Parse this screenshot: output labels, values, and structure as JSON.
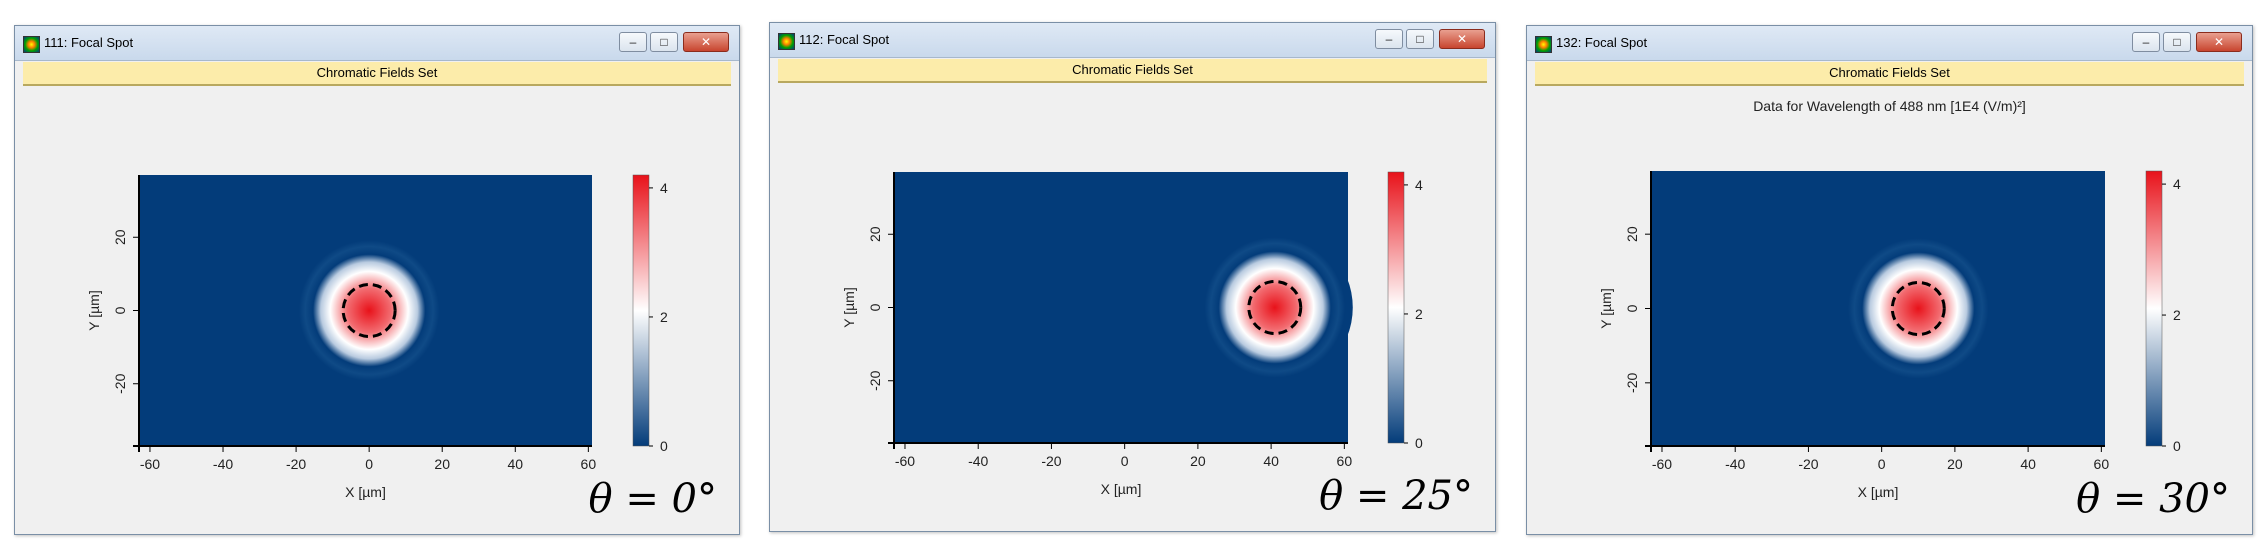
{
  "windows": [
    {
      "title": "111: Focal Spot",
      "header": "Chromatic Fields Set",
      "plot_title": "",
      "angle_label": "θ = 0°",
      "spot_x": 0,
      "spot_y": 0,
      "window_buttons": {
        "minimize": "–",
        "maximize": "□",
        "close": "✕"
      }
    },
    {
      "title": "112: Focal Spot",
      "header": "Chromatic Fields Set",
      "plot_title": "",
      "angle_label": "θ = 25°",
      "spot_x": 41,
      "spot_y": 0,
      "window_buttons": {
        "minimize": "–",
        "maximize": "□",
        "close": "✕"
      }
    },
    {
      "title": "132: Focal Spot",
      "header": "Chromatic Fields Set",
      "plot_title": "Data for Wavelength of 488 nm  [1E4 (V/m)²]",
      "angle_label": "θ = 30°",
      "spot_x": 10,
      "spot_y": 0,
      "window_buttons": {
        "minimize": "–",
        "maximize": "□",
        "close": "✕"
      }
    }
  ],
  "plot": {
    "xlabel": "X [µm]",
    "ylabel": "Y [µm]",
    "x_ticks": [
      -60,
      -40,
      -20,
      0,
      20,
      40,
      60
    ],
    "y_ticks": [
      -20,
      0,
      20
    ],
    "xlim": [
      -63,
      61
    ],
    "ylim": [
      -37,
      37
    ],
    "colorbar_ticks": [
      0,
      2,
      4
    ],
    "colorbar_range": [
      0,
      4.2
    ],
    "colors": {
      "background": "#033c7a",
      "peak": "#e8121a",
      "mid": "#ffffff",
      "ring": "#000000"
    }
  }
}
